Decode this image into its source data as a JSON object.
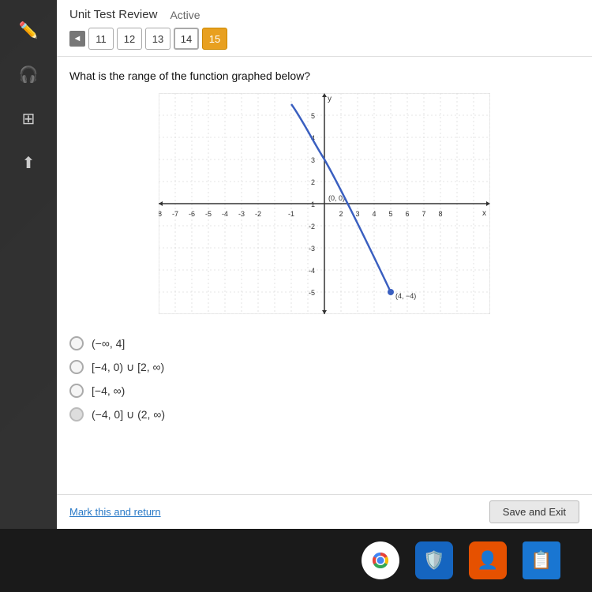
{
  "header": {
    "top_label": "Unit Test",
    "title": "Unit Test Review",
    "status": "Active"
  },
  "tabs": {
    "back_label": "◄",
    "items": [
      {
        "number": "11",
        "active": false
      },
      {
        "number": "12",
        "active": false
      },
      {
        "number": "13",
        "active": false
      },
      {
        "number": "14",
        "active": false
      },
      {
        "number": "15",
        "active": true
      }
    ]
  },
  "question": {
    "text": "What is the range of the function graphed below?"
  },
  "graph": {
    "origin_label": "(0, 0)",
    "point_label": "(4, −4)"
  },
  "answers": [
    {
      "id": "a",
      "text": "(−∞, 4]",
      "disabled": false
    },
    {
      "id": "b",
      "text": "[−4, 0) ∪ [2, ∞)",
      "disabled": false
    },
    {
      "id": "c",
      "text": "[−4, ∞)",
      "disabled": false
    },
    {
      "id": "d",
      "text": "(−4, 0] ∪ (2, ∞)",
      "disabled": true
    }
  ],
  "footer": {
    "mark_return": "Mark this and return",
    "save_exit": "Save and Exit"
  },
  "sidebar": {
    "icons": [
      "✏️",
      "🎧",
      "▦",
      "⬆"
    ]
  }
}
